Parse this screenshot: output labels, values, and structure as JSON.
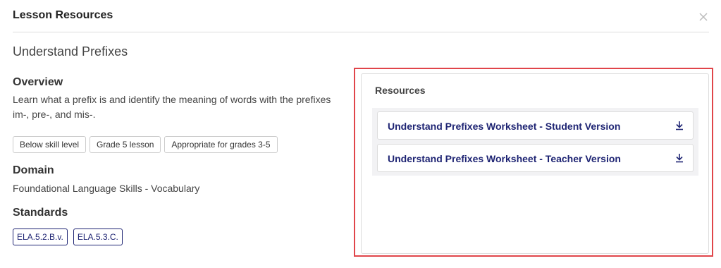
{
  "modal": {
    "title": "Lesson Resources"
  },
  "lesson": {
    "title": "Understand Prefixes"
  },
  "overview": {
    "heading": "Overview",
    "text": "Learn what a prefix is and identify the meaning of words with the prefixes im-, pre-, and mis-.",
    "tags": [
      "Below skill level",
      "Grade 5 lesson",
      "Appropriate for grades 3-5"
    ]
  },
  "domain": {
    "heading": "Domain",
    "text": "Foundational Language Skills - Vocabulary"
  },
  "standards": {
    "heading": "Standards",
    "items": [
      "ELA.5.2.B.v.",
      "ELA.5.3.C."
    ]
  },
  "resources": {
    "heading": "Resources",
    "items": [
      {
        "label": "Understand Prefixes Worksheet - Student Version",
        "icon": "download-icon"
      },
      {
        "label": "Understand Prefixes Worksheet - Teacher Version",
        "icon": "download-icon"
      }
    ]
  },
  "colors": {
    "link": "#1e2473",
    "highlight": "#e0454a"
  }
}
